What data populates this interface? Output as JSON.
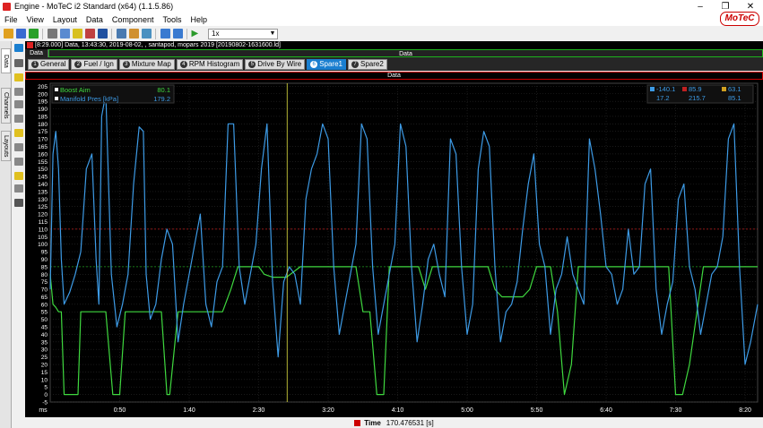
{
  "window": {
    "title": "Engine - MoTeC i2 Standard (x64) (1.1.5.86)",
    "controls": [
      "–",
      "❐",
      "✕"
    ]
  },
  "menu": [
    "File",
    "View",
    "Layout",
    "Data",
    "Component",
    "Tools",
    "Help"
  ],
  "logo": "MoTeC",
  "toolbar": {
    "zoom_value": "1x",
    "buttons": [
      "open-icon",
      "save-icon",
      "export-icon",
      "print-icon",
      "copy-icon",
      "layout-icon",
      "cut-icon",
      "save-layout-icon",
      "grid-icon",
      "overlay-icon",
      "fit-icon",
      "nav-back-icon",
      "nav-fwd-icon",
      "play-icon"
    ]
  },
  "sidebar": {
    "tabs": [
      "Data",
      "Channels",
      "Layouts"
    ]
  },
  "info": {
    "text": "[8:29.000] Data, 13:43:30, 2019-08-02, , santapod, mopars 2019 [20190802-1631600.ld]"
  },
  "databar": {
    "left": "Data",
    "right": "Data"
  },
  "tabs": [
    {
      "num": "1",
      "label": "General"
    },
    {
      "num": "2",
      "label": "Fuel / Ign"
    },
    {
      "num": "3",
      "label": "Mixture Map"
    },
    {
      "num": "4",
      "label": "RPM Histogram"
    },
    {
      "num": "5",
      "label": "Drive By Wire"
    },
    {
      "num": "6",
      "label": "Spare1"
    },
    {
      "num": "7",
      "label": "Spare2"
    }
  ],
  "active_tab": 5,
  "chart": {
    "header_title": "Data",
    "legend": [
      {
        "name": "Boost Aim",
        "value": "80.1",
        "color": "#3fd83f"
      },
      {
        "name": "Manifold Pres [kPa]",
        "value": "179.2",
        "color": "#3d9be6"
      }
    ],
    "stats_header": {
      "min": "-140.1",
      "max": "85.9",
      "avg": "63.1"
    },
    "stats_row": {
      "min": "17.2",
      "max": "215.7",
      "avg": "85.1"
    },
    "x_unit": "ms",
    "cursor_x_seconds": 170.476531
  },
  "chart_data": {
    "type": "line",
    "ylim": [
      -5,
      207
    ],
    "y_ticks": [
      -5,
      0,
      5,
      10,
      15,
      20,
      25,
      30,
      35,
      40,
      45,
      50,
      55,
      60,
      65,
      70,
      75,
      80,
      85,
      90,
      95,
      100,
      105,
      110,
      115,
      120,
      125,
      130,
      135,
      140,
      145,
      150,
      155,
      160,
      165,
      170,
      175,
      180,
      185,
      190,
      195,
      200,
      205
    ],
    "reference_lines": [
      110,
      85
    ],
    "xlim": [
      0,
      509
    ],
    "x_ticks": [
      {
        "v": 50,
        "label": "0:50"
      },
      {
        "v": 100,
        "label": "1:40"
      },
      {
        "v": 150,
        "label": "2:30"
      },
      {
        "v": 200,
        "label": "3:20"
      },
      {
        "v": 250,
        "label": "4:10"
      },
      {
        "v": 300,
        "label": "5:00"
      },
      {
        "v": 350,
        "label": "5:50"
      },
      {
        "v": 400,
        "label": "6:40"
      },
      {
        "v": 450,
        "label": "7:30"
      },
      {
        "v": 500,
        "label": "8:20"
      }
    ],
    "series": [
      {
        "name": "Manifold Pres [kPa]",
        "color": "#3d9be6",
        "x": [
          0,
          2,
          4,
          6,
          8,
          10,
          14,
          18,
          22,
          26,
          30,
          33,
          35,
          37,
          40,
          44,
          48,
          52,
          56,
          60,
          64,
          67,
          69,
          72,
          76,
          80,
          84,
          88,
          92,
          96,
          100,
          104,
          108,
          112,
          116,
          120,
          124,
          128,
          132,
          136,
          140,
          144,
          148,
          152,
          156,
          160,
          164,
          168,
          172,
          176,
          180,
          184,
          188,
          192,
          196,
          200,
          204,
          208,
          212,
          216,
          220,
          224,
          228,
          232,
          236,
          240,
          244,
          248,
          252,
          256,
          260,
          264,
          268,
          272,
          276,
          280,
          284,
          288,
          292,
          296,
          300,
          304,
          308,
          312,
          316,
          320,
          324,
          328,
          332,
          336,
          340,
          344,
          348,
          352,
          356,
          360,
          364,
          368,
          372,
          376,
          380,
          384,
          388,
          392,
          396,
          400,
          404,
          408,
          412,
          416,
          420,
          424,
          428,
          432,
          436,
          440,
          444,
          448,
          452,
          456,
          460,
          464,
          468,
          472,
          476,
          480,
          484,
          488,
          492,
          496,
          500,
          504,
          509
        ],
        "values": [
          70,
          160,
          175,
          150,
          90,
          60,
          68,
          80,
          95,
          150,
          160,
          90,
          60,
          185,
          200,
          80,
          45,
          60,
          80,
          140,
          178,
          175,
          80,
          50,
          60,
          90,
          110,
          100,
          35,
          60,
          80,
          100,
          120,
          60,
          45,
          75,
          85,
          180,
          180,
          85,
          60,
          80,
          100,
          150,
          180,
          75,
          25,
          75,
          85,
          80,
          60,
          130,
          150,
          160,
          180,
          170,
          85,
          40,
          60,
          80,
          100,
          180,
          170,
          85,
          40,
          60,
          80,
          100,
          180,
          165,
          85,
          35,
          60,
          90,
          100,
          80,
          65,
          170,
          160,
          85,
          40,
          60,
          150,
          175,
          165,
          85,
          35,
          55,
          60,
          75,
          110,
          140,
          160,
          100,
          85,
          40,
          70,
          80,
          105,
          80,
          70,
          60,
          170,
          150,
          120,
          85,
          80,
          60,
          70,
          110,
          80,
          85,
          140,
          150,
          70,
          40,
          60,
          75,
          130,
          140,
          85,
          70,
          40,
          60,
          80,
          85,
          105,
          170,
          180,
          85,
          20,
          35,
          60
        ]
      },
      {
        "name": "Boost Aim",
        "color": "#3fd83f",
        "x": [
          0,
          2,
          4,
          6,
          8,
          10,
          20,
          22,
          30,
          34,
          40,
          45,
          50,
          54,
          58,
          60,
          80,
          84,
          86,
          92,
          96,
          100,
          110,
          115,
          120,
          124,
          130,
          135,
          140,
          146,
          150,
          154,
          160,
          170,
          180,
          200,
          220,
          225,
          230,
          235,
          240,
          244,
          250,
          255,
          260,
          265,
          270,
          275,
          280,
          285,
          290,
          295,
          300,
          305,
          310,
          315,
          320,
          325,
          330,
          335,
          340,
          345,
          350,
          355,
          360,
          365,
          370,
          375,
          380,
          385,
          390,
          395,
          400,
          405,
          410,
          415,
          420,
          425,
          430,
          435,
          440,
          445,
          450,
          455,
          460,
          470,
          480,
          490,
          500,
          509
        ],
        "values": [
          80,
          60,
          58,
          55,
          55,
          0,
          0,
          55,
          55,
          55,
          55,
          0,
          0,
          55,
          55,
          55,
          55,
          0,
          0,
          55,
          55,
          55,
          55,
          55,
          55,
          55,
          70,
          85,
          85,
          85,
          85,
          80,
          78,
          78,
          85,
          85,
          85,
          55,
          55,
          0,
          0,
          85,
          85,
          85,
          85,
          85,
          70,
          85,
          85,
          85,
          85,
          85,
          85,
          85,
          85,
          85,
          70,
          65,
          65,
          65,
          65,
          70,
          85,
          85,
          85,
          55,
          0,
          20,
          85,
          85,
          85,
          85,
          85,
          85,
          85,
          85,
          85,
          85,
          85,
          85,
          85,
          85,
          0,
          0,
          20,
          85,
          85,
          85,
          85,
          85
        ]
      }
    ]
  },
  "status": {
    "label": "Time",
    "value": "170.476531 [s]"
  }
}
